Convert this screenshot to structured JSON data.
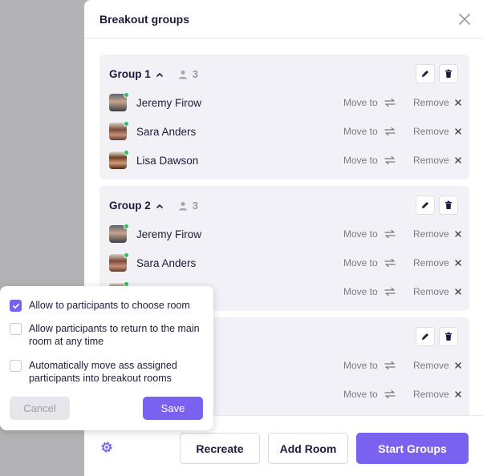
{
  "modal": {
    "title": "Breakout groups"
  },
  "labels": {
    "move_to": "Move to",
    "remove": "Remove"
  },
  "groups": [
    {
      "name": "Group 1",
      "count": "3",
      "members": [
        "Jeremy Firow",
        "Sara Anders",
        "Lisa Dawson"
      ]
    },
    {
      "name": "Group 2",
      "count": "3",
      "members": [
        "Jeremy Firow",
        "Sara Anders",
        ""
      ]
    },
    {
      "name": "",
      "count": "",
      "members": [
        "",
        ""
      ]
    }
  ],
  "footer": {
    "recreate": "Recreate",
    "add_room": "Add Room",
    "start_groups": "Start Groups"
  },
  "settings": {
    "options": [
      {
        "label": "Allow to participants to choose room",
        "checked": true
      },
      {
        "label": "Allow participants to return to the main room at any time",
        "checked": false
      },
      {
        "label": "Automatically move ass assigned participants into breakout rooms",
        "checked": false
      }
    ],
    "cancel": "Cancel",
    "save": "Save"
  },
  "colors": {
    "accent": "#7b61f0",
    "online": "#2fbf5b",
    "group_bg": "#f2f2f6"
  }
}
